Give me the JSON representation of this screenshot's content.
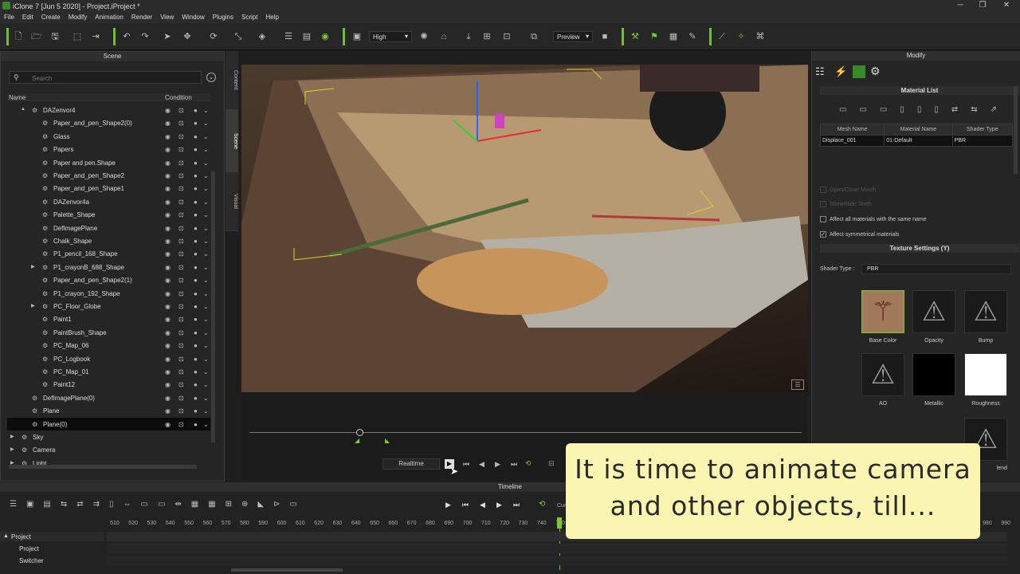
{
  "window": {
    "title": "iClone 7 [Jun  5 2020] - Project.iProject *"
  },
  "menu": [
    "File",
    "Edit",
    "Create",
    "Modify",
    "Animation",
    "Render",
    "View",
    "Window",
    "Plugins",
    "Script",
    "Help"
  ],
  "toolbar": {
    "quality": "High",
    "render_mode": "Preview"
  },
  "scene": {
    "title": "Scene",
    "search_placeholder": "Search",
    "col_name": "Name",
    "col_condition": "Condition",
    "rows": [
      {
        "label": "DAZenvor4",
        "indent": 1,
        "arrow": "▲"
      },
      {
        "label": "Paper_and_pen_Shape2(0)",
        "indent": 2
      },
      {
        "label": "Glass",
        "indent": 2
      },
      {
        "label": "Papers",
        "indent": 2
      },
      {
        "label": "Paper and pen.Shape",
        "indent": 2
      },
      {
        "label": "Paper_and_pen_Shape2",
        "indent": 2
      },
      {
        "label": "Paper_and_pen_Shape1",
        "indent": 2
      },
      {
        "label": "DAZenvor4a",
        "indent": 2
      },
      {
        "label": "Palette_Shape",
        "indent": 2
      },
      {
        "label": "DefImagePlane",
        "indent": 2
      },
      {
        "label": "Chalk_Shape",
        "indent": 2
      },
      {
        "label": "P1_pencil_168_Shape",
        "indent": 2
      },
      {
        "label": "P1_crayonB_688_Shape",
        "indent": 2,
        "arrow": "▶"
      },
      {
        "label": "Paper_and_pen_Shape2(1)",
        "indent": 2
      },
      {
        "label": "P1_crayon_192_Shape",
        "indent": 2
      },
      {
        "label": "PC_Floor_Globe",
        "indent": 2,
        "arrow": "▶"
      },
      {
        "label": "Paint1",
        "indent": 2
      },
      {
        "label": "PaintBrush_Shape",
        "indent": 2
      },
      {
        "label": "PC_Map_06",
        "indent": 2
      },
      {
        "label": "PC_Logbook",
        "indent": 2
      },
      {
        "label": "PC_Map_01",
        "indent": 2
      },
      {
        "label": "Paint12",
        "indent": 2
      },
      {
        "label": "DefImagePlane(0)",
        "indent": 1
      },
      {
        "label": "Plane",
        "indent": 1
      },
      {
        "label": "Plane(0)",
        "indent": 1,
        "selected": true
      },
      {
        "label": "Sky",
        "indent": 0,
        "arrow": "▶"
      },
      {
        "label": "Camera",
        "indent": 0,
        "arrow": "▶"
      },
      {
        "label": "Light",
        "indent": 0,
        "arrow": "▶"
      }
    ]
  },
  "sidetabs": [
    "Content",
    "Scene",
    "Visual"
  ],
  "playback": {
    "mode": "Realtime"
  },
  "modify": {
    "title": "Modify",
    "material_list": "Material List",
    "cols": [
      "Mesh Name",
      "Material Name",
      "Shader Type"
    ],
    "row": [
      "Displace_001",
      "01-Default",
      "PBR"
    ],
    "open_mouth": "Open/Close Mouth",
    "show_teeth": "Show/Hide Teeth",
    "affect_same": "Affect all materials with the same name",
    "affect_sym": "Affect symmetrical materials",
    "texture_settings": "Texture Settings  (Y)",
    "shader_type_label": "Shader Type :",
    "shader_type_value": "PBR",
    "textures": [
      "Base Color",
      "Opacity",
      "Bump",
      "AO",
      "Metallic",
      "Roughness",
      "lend"
    ]
  },
  "timeline": {
    "title": "Timeline",
    "ticks": [
      "510",
      "520",
      "530",
      "540",
      "550",
      "560",
      "570",
      "580",
      "590",
      "600",
      "610",
      "620",
      "630",
      "640",
      "650",
      "660",
      "670",
      "680",
      "690",
      "700",
      "710",
      "720",
      "730",
      "740",
      "750",
      "760",
      "770",
      "780",
      "790",
      "800",
      "810",
      "820",
      "830",
      "840",
      "850",
      "860",
      "870",
      "880",
      "890",
      "900",
      "910",
      "920",
      "930",
      "940",
      "950",
      "960",
      "970",
      "980",
      "990"
    ],
    "tracks": [
      "Project",
      "Project",
      "Switcher"
    ],
    "current_frame_label": "Current Frame"
  },
  "caption": {
    "line1": "It is time to animate camera",
    "line2": "and other objects, till..."
  }
}
